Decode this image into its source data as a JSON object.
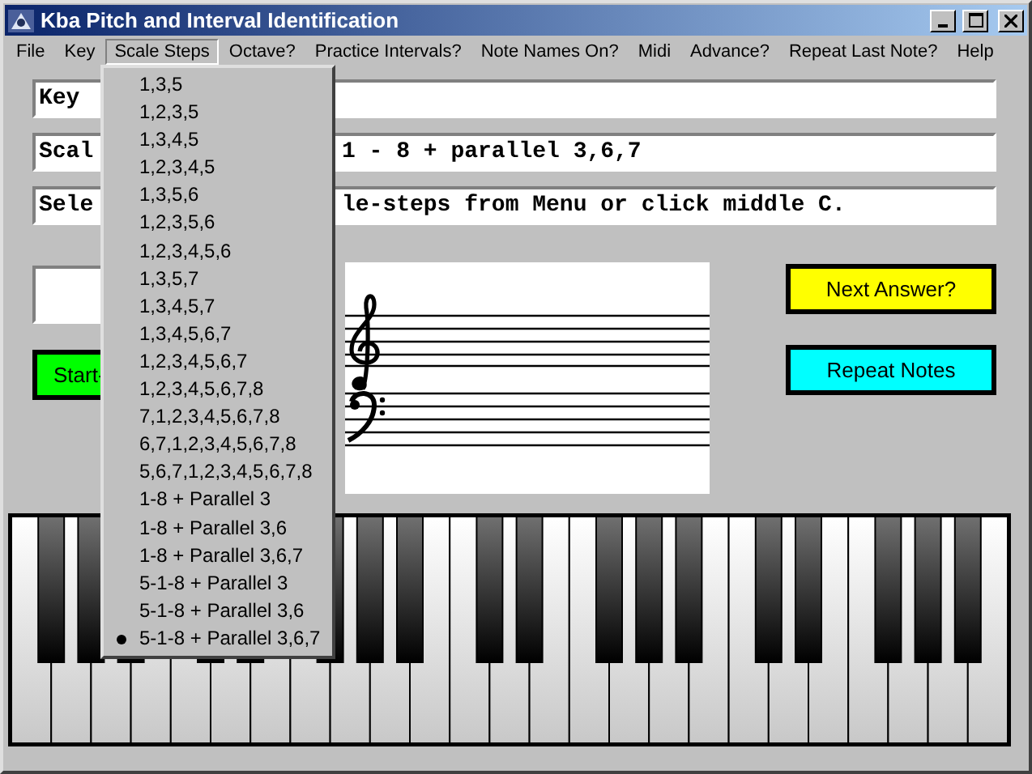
{
  "window": {
    "title": "Kba Pitch and Interval Identification"
  },
  "menu_bar": [
    {
      "label": "File",
      "selected": false
    },
    {
      "label": "Key",
      "selected": false
    },
    {
      "label": "Scale Steps",
      "selected": true
    },
    {
      "label": "Octave?",
      "selected": false
    },
    {
      "label": "Practice Intervals?",
      "selected": false
    },
    {
      "label": "Note Names On?",
      "selected": false
    },
    {
      "label": "Midi",
      "selected": false
    },
    {
      "label": "Advance?",
      "selected": false
    },
    {
      "label": "Repeat Last Note?",
      "selected": false
    },
    {
      "label": "Help",
      "selected": false
    }
  ],
  "scale_steps_menu": [
    {
      "label": "1,3,5",
      "checked": false
    },
    {
      "label": "1,2,3,5",
      "checked": false
    },
    {
      "label": "1,3,4,5",
      "checked": false
    },
    {
      "label": "1,2,3,4,5",
      "checked": false
    },
    {
      "label": "1,3,5,6",
      "checked": false
    },
    {
      "label": "1,2,3,5,6",
      "checked": false
    },
    {
      "label": "1,2,3,4,5,6",
      "checked": false
    },
    {
      "label": "1,3,5,7",
      "checked": false
    },
    {
      "label": "1,3,4,5,7",
      "checked": false
    },
    {
      "label": "1,3,4,5,6,7",
      "checked": false
    },
    {
      "label": "1,2,3,4,5,6,7",
      "checked": false
    },
    {
      "label": "1,2,3,4,5,6,7,8",
      "checked": false
    },
    {
      "label": "7,1,2,3,4,5,6,7,8",
      "checked": false
    },
    {
      "label": "6,7,1,2,3,4,5,6,7,8",
      "checked": false
    },
    {
      "label": "5,6,7,1,2,3,4,5,6,7,8",
      "checked": false
    },
    {
      "label": "1-8 + Parallel 3",
      "checked": false
    },
    {
      "label": "1-8 + Parallel 3,6",
      "checked": false
    },
    {
      "label": "1-8 + Parallel 3,6,7",
      "checked": false
    },
    {
      "label": "5-1-8 + Parallel 3",
      "checked": false
    },
    {
      "label": "5-1-8 + Parallel 3,6",
      "checked": false
    },
    {
      "label": "5-1-8 + Parallel 3,6,7",
      "checked": true
    }
  ],
  "fields": [
    {
      "text": "Key"
    },
    {
      "text": "Scal",
      "text_after_menu": "1 - 8 + parallel 3,6,7"
    },
    {
      "text": "Sele",
      "text_after_menu": "le-steps from Menu or click middle C."
    }
  ],
  "start_button": {
    "label": "Start-"
  },
  "buttons": [
    {
      "label": "Next Answer?",
      "color": "#ffff00"
    },
    {
      "label": "Repeat Notes",
      "color": "#00ffff"
    }
  ]
}
